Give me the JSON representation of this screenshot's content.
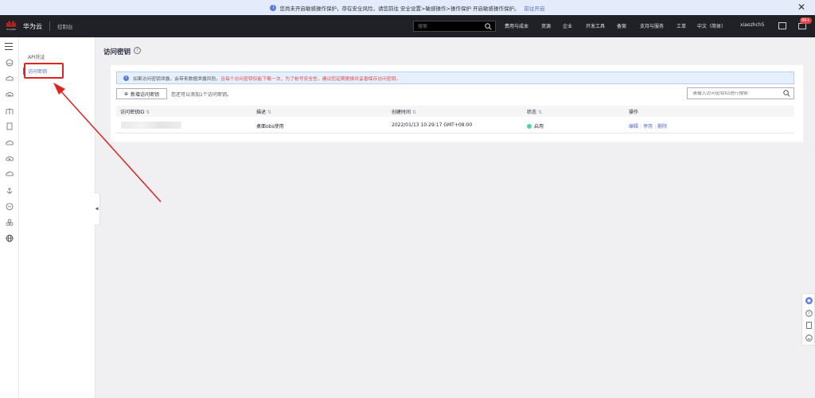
{
  "notice": {
    "text": "您尚未开启敏感操作保护，存在安全风险，请您前往 安全设置>敏感操作>操作保护 开启敏感操作保护。",
    "link": "前往开启"
  },
  "header": {
    "brand": "华为云",
    "logo_text": "HUAWEI",
    "console": "控制台",
    "search_placeholder": "搜索",
    "nav": [
      "费用与成本",
      "资源",
      "企业",
      "开发工具",
      "备案",
      "支持与服务",
      "工单",
      "中文（简体）",
      "xiaozhch5"
    ],
    "badge": "99+"
  },
  "sidebar": {
    "items": [
      {
        "label": "API凭证"
      },
      {
        "label": "访问密钥"
      }
    ]
  },
  "main": {
    "title": "访问密钥",
    "tip": {
      "prefix": "如果访问密钥泄露，会带来数据泄露风险。",
      "warning": "且每个访问密钥仅能下载一次，为了帐号安全性，建议您定期更换并妥善保存访问密钥。"
    },
    "create_button": "新增访问密钥",
    "quota_text": "您还可以添加1个访问密钥。",
    "filter_placeholder": "请输入访问密钥ID进行搜索",
    "table": {
      "columns": [
        "访问密钥ID",
        "描述",
        "创建时间",
        "状态",
        "操作"
      ],
      "rows": [
        {
          "description": "桌面obs使用",
          "created": "2022/01/13 10:29:17 GMT+08:00",
          "status": "启用",
          "actions": [
            "编辑",
            "停用",
            "删除"
          ]
        }
      ]
    }
  },
  "colors": {
    "accent": "#526ecc",
    "header_bg": "#1f2126",
    "highlight_red": "#e0231c",
    "status_green": "#50d4ab"
  }
}
